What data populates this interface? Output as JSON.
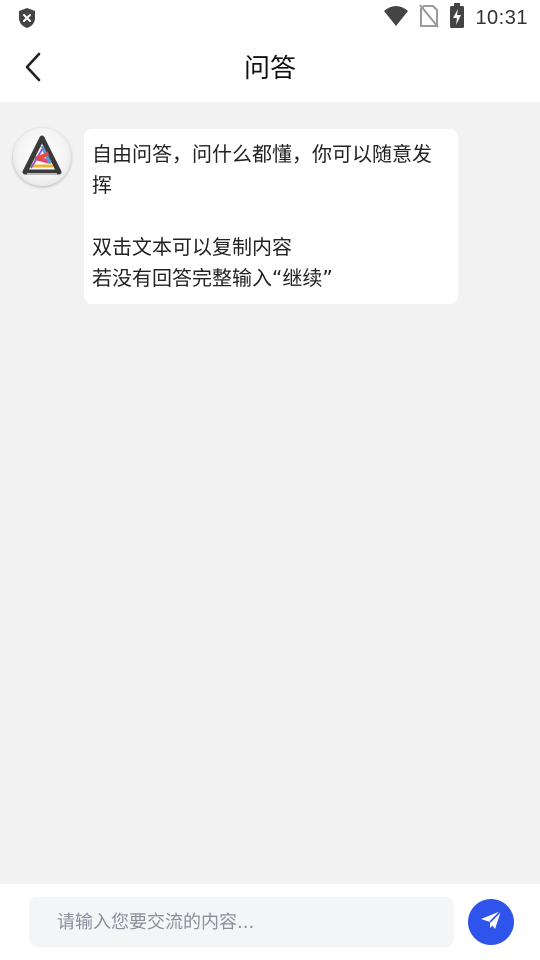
{
  "status_bar": {
    "time": "10:31",
    "icons": [
      "shield-icon",
      "wifi-icon",
      "no-sim-icon",
      "battery-charging-icon"
    ]
  },
  "header": {
    "title": "问答",
    "back_icon": "chevron-left-icon"
  },
  "chat": {
    "messages": [
      {
        "sender": "bot",
        "avatar_icon": "bot-avatar-logo",
        "lines": [
          "自由问答，问什么都懂，你可以随意发",
          "挥",
          "",
          "双击文本可以复制内容",
          "若没有回答完整输入“继续”"
        ]
      }
    ]
  },
  "composer": {
    "placeholder": "请输入您要交流的内容...",
    "value": "",
    "send_icon": "paper-plane-icon"
  },
  "colors": {
    "accent": "#2f54eb",
    "background": "#f2f2f2",
    "surface": "#ffffff",
    "text": "#222222",
    "placeholder": "#8a8f99"
  }
}
